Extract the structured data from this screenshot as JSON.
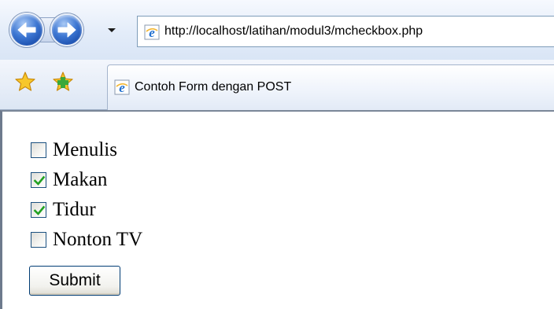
{
  "browser": {
    "address": {
      "url": "http://localhost/latihan/modul3/mcheckbox.php",
      "page_icon": "ie-page-icon"
    },
    "nav": {
      "back_icon": "back-arrow-icon",
      "forward_icon": "forward-arrow-icon",
      "recent_icon": "dropdown-arrow-icon"
    },
    "toolbar": {
      "favorites_icon": "star-icon",
      "add_favorite_icon": "add-favorite-icon"
    },
    "tab": {
      "title": "Contoh Form dengan POST",
      "icon": "ie-page-icon"
    }
  },
  "form": {
    "options": [
      {
        "label": "Menulis",
        "checked": false
      },
      {
        "label": "Makan",
        "checked": true
      },
      {
        "label": "Tidur",
        "checked": true
      },
      {
        "label": "Nonton TV",
        "checked": false
      }
    ],
    "submit_label": "Submit"
  },
  "colors": {
    "checkmark": "#21a121",
    "checkbox_border": "#1c5180"
  }
}
